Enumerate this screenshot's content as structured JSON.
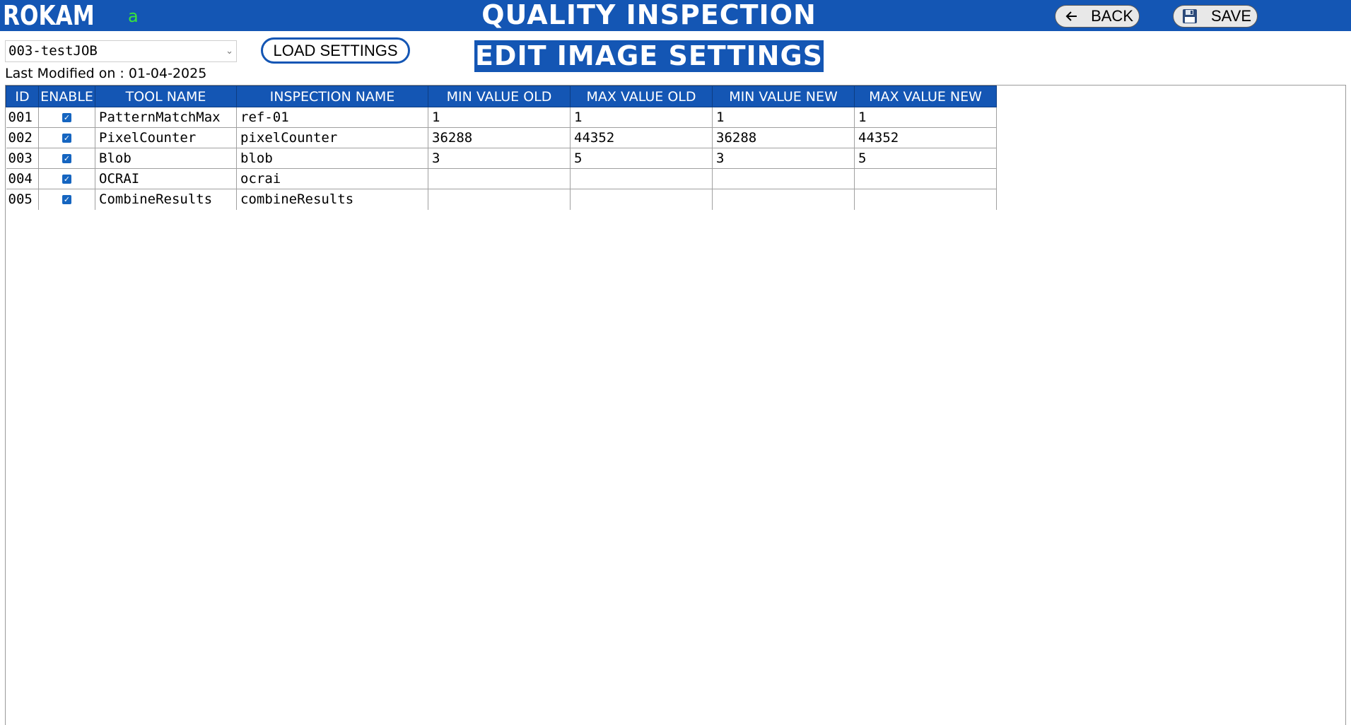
{
  "header": {
    "logo": "ROKAM",
    "user_initial": "a",
    "title": "QUALITY INSPECTION",
    "back_label": "BACK",
    "save_label": "SAVE"
  },
  "controls": {
    "job_select_value": "003-testJOB",
    "load_button_label": "LOAD SETTINGS",
    "section_title": "EDIT IMAGE SETTINGS",
    "last_modified_label": "Last Modified on : ",
    "last_modified_date": "01-04-2025"
  },
  "table": {
    "columns": [
      "ID",
      "ENABLE",
      "TOOL NAME",
      "INSPECTION NAME",
      "MIN VALUE OLD",
      "MAX VALUE OLD",
      "MIN VALUE NEW",
      "MAX VALUE NEW"
    ],
    "rows": [
      {
        "id": "001",
        "enabled": true,
        "tool": "PatternMatchMax",
        "inspection": "ref-01",
        "min_old": "1",
        "max_old": "1",
        "min_new": "1",
        "max_new": "1"
      },
      {
        "id": "002",
        "enabled": true,
        "tool": "PixelCounter",
        "inspection": "pixelCounter",
        "min_old": "36288",
        "max_old": "44352",
        "min_new": "36288",
        "max_new": "44352"
      },
      {
        "id": "003",
        "enabled": true,
        "tool": "Blob",
        "inspection": "blob",
        "min_old": "3",
        "max_old": "5",
        "min_new": "3",
        "max_new": "5"
      },
      {
        "id": "004",
        "enabled": true,
        "tool": "OCRAI",
        "inspection": "ocrai",
        "min_old": "",
        "max_old": "",
        "min_new": "",
        "max_new": ""
      },
      {
        "id": "005",
        "enabled": true,
        "tool": "CombineResults",
        "inspection": "combineResults",
        "min_old": "",
        "max_old": "",
        "min_new": "",
        "max_new": ""
      }
    ]
  },
  "icons": {
    "back": "arrow-left-icon",
    "save": "floppy-disk-icon",
    "checkbox": "checkmark-icon",
    "dropdown": "chevron-down-icon"
  },
  "colors": {
    "brand_blue": "#1456b4",
    "user_initial_green": "#39e639",
    "checkbox_blue": "#1565c0"
  }
}
